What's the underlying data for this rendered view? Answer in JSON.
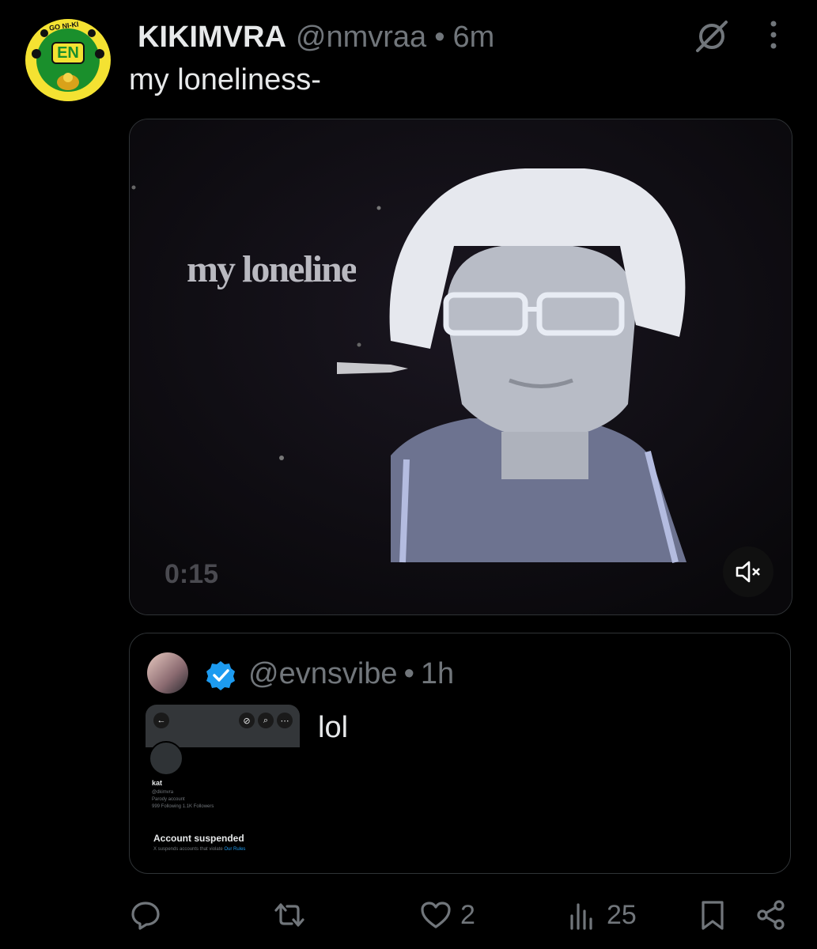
{
  "post": {
    "display_name": "KIKIMVRA",
    "handle": "@nmvraa",
    "separator": "•",
    "time": "6m",
    "text": "my loneliness-",
    "avatar": {
      "badge_top": "GO NI-KI",
      "badge_center": "EN"
    },
    "media": {
      "overlay_text": "my loneline",
      "duration": "0:15",
      "mute_icon": "speaker-muted-icon"
    }
  },
  "quote": {
    "handle": "@evnsvibe",
    "separator": "•",
    "time": "1h",
    "text": "lol",
    "thumbnail": {
      "name": "kat",
      "handle": "@dkimvra",
      "bio": "Parody account",
      "stats": "999 Following  1.1K Followers",
      "suspended_title": "Account suspended",
      "suspended_note": "X suspends accounts that violate ",
      "rules_link": "Our Rules"
    }
  },
  "actions": {
    "reply": {
      "icon": "reply-icon",
      "count": ""
    },
    "repost": {
      "icon": "repost-icon",
      "count": ""
    },
    "like": {
      "icon": "heart-icon",
      "count": "2"
    },
    "views": {
      "icon": "views-icon",
      "count": "25"
    },
    "bookmark": {
      "icon": "bookmark-icon"
    },
    "share": {
      "icon": "share-icon"
    }
  },
  "colors": {
    "background": "#000000",
    "text": "#e7e9ea",
    "muted": "#71767b",
    "border": "#2f3336",
    "verified": "#1d9bf0",
    "avatar_badge": "#f4e232",
    "avatar_badge_inner": "#1a8f2c"
  }
}
